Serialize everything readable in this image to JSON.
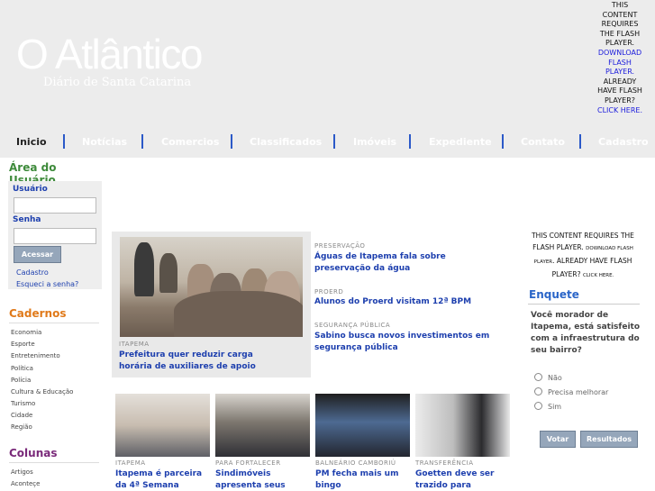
{
  "header": {
    "logo": "O Atlântico",
    "subtitle": "Diário de Santa Catarina",
    "flash_top": {
      "text1": "This content requires the Flash Player.",
      "link1": "Download Flash Player.",
      "text2": "Already have Flash Player?",
      "link2": "Click here."
    }
  },
  "nav": {
    "items": [
      "Inicio",
      "Notícias",
      "Comercios",
      "Classificados",
      "Imóveis",
      "Expediente",
      "Contato",
      "Cadastro"
    ],
    "active": "Inicio",
    "separator_color": "#2b59c8"
  },
  "sidebar": {
    "area_title": "Área do Usuário",
    "user_label": "Usuário",
    "password_label": "Senha",
    "user_value": "",
    "password_value": "",
    "login_button": "Acessar",
    "register_link": "Cadastro",
    "forgot_link": "Esqueci a senha?",
    "cadernos_title": "Cadernos",
    "cadernos_color": "#e07a1a",
    "cadernos": [
      "Economia",
      "Esporte",
      "Entretenimento",
      "Política",
      "Polícia",
      "Cultura & Educação",
      "Turismo",
      "Cidade",
      "Região"
    ],
    "colunas_title": "Colunas",
    "colunas_color": "#7a2a7a",
    "colunas": [
      "Artigos",
      "Aconteçe"
    ]
  },
  "featured": {
    "kicker": "ITAPEMA",
    "headline": "Prefeitura quer reduzir carga horária de auxiliares de apoio"
  },
  "side_news": [
    {
      "kicker": "PRESERVAÇÃO",
      "headline": "Águas de Itapema fala sobre preservação da água"
    },
    {
      "kicker": "PROERD",
      "headline": "Alunos do Proerd visitam 12ª BPM"
    },
    {
      "kicker": "SEGURANÇA PÚBLICA",
      "headline": "Sabino busca novos investimentos em segurança pública"
    }
  ],
  "bottom_news": [
    {
      "kicker": "ITAPEMA",
      "headline": "Itapema é parceira da 4ª Semana"
    },
    {
      "kicker": "PARA FORTALECER",
      "headline": "Sindimóveis apresenta seus delegados"
    },
    {
      "kicker": "BALNEÁRIO CAMBORIÚ",
      "headline": "PM fecha mais um bingo"
    },
    {
      "kicker": "TRANSFERÊNCIA",
      "headline": "Goetten deve ser trazido para Itapema"
    }
  ],
  "right": {
    "flash": {
      "text1": "This content requires the Flash Player.",
      "link1": "Download Flash Player",
      "text2": ". Already have Flash Player?",
      "link2": "Click here."
    },
    "enquete_title": "Enquete",
    "question": "Você morador de Itapema, está satisfeito com a infraestrutura do seu bairro?",
    "options": [
      "Não",
      "Precisa melhorar",
      "Sim"
    ],
    "vote_button": "Votar",
    "results_button": "Resultados"
  }
}
